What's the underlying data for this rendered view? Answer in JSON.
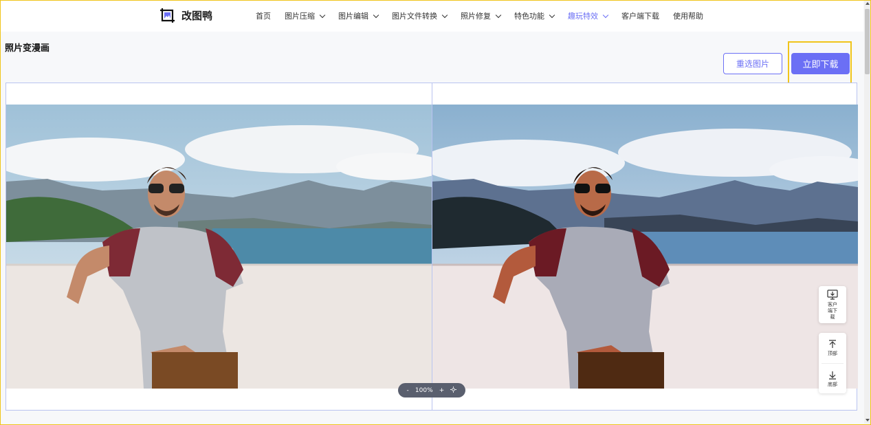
{
  "brand": {
    "name": "改图鸭"
  },
  "nav": [
    {
      "label": "首页",
      "dropdown": false,
      "active": false
    },
    {
      "label": "图片压缩",
      "dropdown": true,
      "active": false
    },
    {
      "label": "图片编辑",
      "dropdown": true,
      "active": false
    },
    {
      "label": "图片文件转换",
      "dropdown": true,
      "active": false
    },
    {
      "label": "照片修复",
      "dropdown": true,
      "active": false
    },
    {
      "label": "特色功能",
      "dropdown": true,
      "active": false
    },
    {
      "label": "趣玩特效",
      "dropdown": true,
      "active": true
    },
    {
      "label": "客户端下载",
      "dropdown": false,
      "active": false
    },
    {
      "label": "使用帮助",
      "dropdown": false,
      "active": false
    }
  ],
  "page": {
    "title": "照片变漫画"
  },
  "actions": {
    "reselect_label": "重选图片",
    "download_label": "立即下载"
  },
  "zoom": {
    "minus": "-",
    "value": "100%",
    "plus": "+"
  },
  "side_tools": {
    "client_label": "客户端下载",
    "top_label": "顶部",
    "bottom_label": "底部"
  },
  "colors": {
    "accent": "#6b6ff5",
    "highlight": "#f0c419",
    "zoom_bg": "#5a5f6e"
  },
  "icons": [
    "logo-icon",
    "chevron-down-icon",
    "monitor-download-icon",
    "arrow-up-icon",
    "arrow-down-icon",
    "reset-icon"
  ]
}
